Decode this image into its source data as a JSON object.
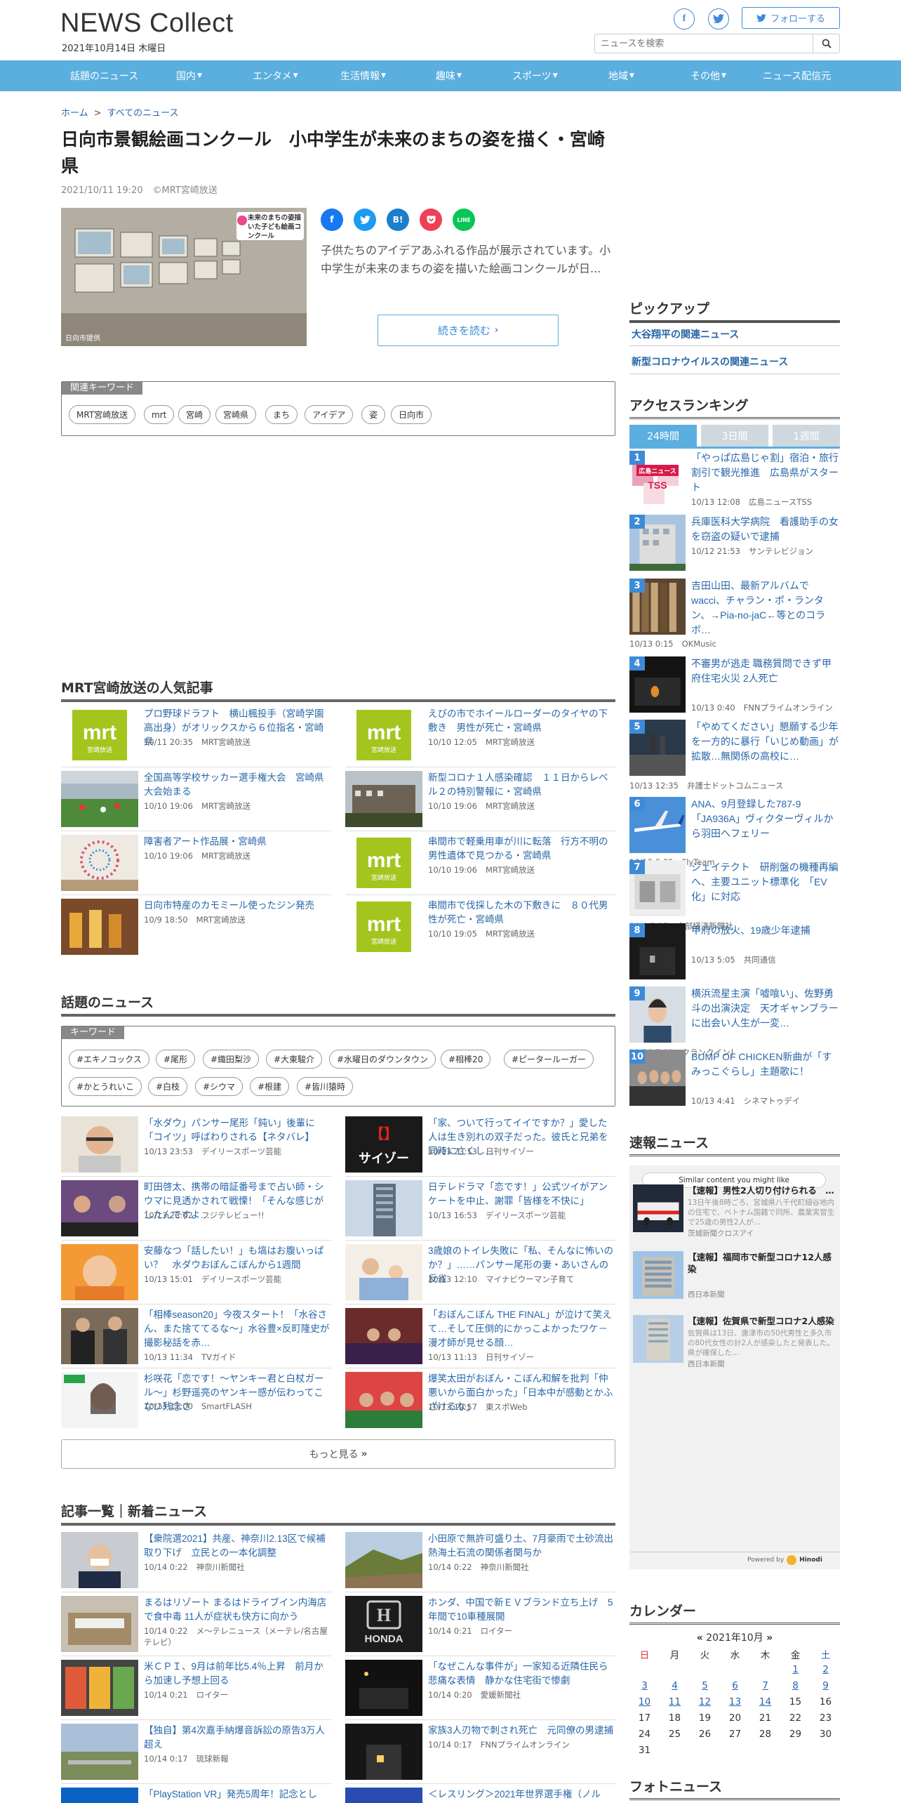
{
  "header": {
    "logo": "NEWS Collect",
    "date": "2021年10月14日 木曜日",
    "follow_label": "フォローする",
    "search_placeholder": "ニュースを検索"
  },
  "nav": [
    "話題のニュース",
    "国内",
    "エンタメ",
    "生活情報",
    "趣味",
    "スポーツ",
    "地域",
    "その他",
    "ニュース配信元"
  ],
  "breadcrumb": {
    "home": "ホーム",
    "sep": ">",
    "current": "すべてのニュース"
  },
  "article": {
    "title": "日向市景観絵画コンクール　小中学生が未来のまちの姿を描く・宮崎県",
    "date": "2021/10/11 19:20",
    "source": "©MRT宮崎放送",
    "image_credit": "日向市提供",
    "image_caption": "未来のまちの姿描いた子ども絵画コンクール",
    "lead": "子供たちのアイデアあふれる作品が展示されています。小中学生が未来のまちの姿を描いた絵画コンクールが日...",
    "read_more": "続きを読む",
    "share": [
      "f",
      "t",
      "B!",
      "P",
      "LINE"
    ]
  },
  "related_keywords": {
    "label": "関連キーワード",
    "items": [
      "MRT宮崎放送",
      "mrt",
      "宮崎",
      "宮崎県",
      "まち",
      "アイデア",
      "姿",
      "日向市"
    ]
  },
  "popular": {
    "title": "MRT宮崎放送の人気記事",
    "logo_text": "mrt",
    "logo_sub": "宮崎放送",
    "items": [
      {
        "title": "プロ野球ドラフト　横山楓投手（宮崎学園高出身）がオリックスから６位指名・宮崎県",
        "time": "10/11 20:35",
        "source": "MRT宮崎放送",
        "thumb": "logo"
      },
      {
        "title": "えびの市でホイールローダーのタイヤの下敷き　男性が死亡・宮崎県",
        "time": "10/10 12:05",
        "source": "MRT宮崎放送",
        "thumb": "logo"
      },
      {
        "title": "全国高等学校サッカー選手権大会　宮崎県大会始まる",
        "time": "10/10 19:06",
        "source": "MRT宮崎放送",
        "thumb": "soccer"
      },
      {
        "title": "新型コロナ１人感染確認　１１日からレベル２の特別警報に・宮崎県",
        "time": "10/10 19:06",
        "source": "MRT宮崎放送",
        "thumb": "building"
      },
      {
        "title": "障害者アート作品展・宮崎県",
        "time": "10/10 19:06",
        "source": "MRT宮崎放送",
        "thumb": "art"
      },
      {
        "title": "串間市で軽乗用車が川に転落　行方不明の男性遺体で見つかる・宮崎県",
        "time": "10/10 19:06",
        "source": "MRT宮崎放送",
        "thumb": "logo"
      },
      {
        "title": "日向市特産のカモミール使ったジン発売",
        "time": "10/9 18:50",
        "source": "MRT宮崎放送",
        "thumb": "bottles"
      },
      {
        "title": "串間市で伐採した木の下敷きに　８０代男性が死亡・宮崎県",
        "time": "10/10 19:05",
        "source": "MRT宮崎放送",
        "thumb": "logo"
      }
    ]
  },
  "topics": {
    "title": "話題のニュース",
    "keyword_label": "キーワード",
    "keywords": [
      "#エキノコックス",
      "#尾形",
      "#織田梨沙",
      "#大東駿介",
      "#水曜日のダウンタウン",
      "#相棒20",
      "#ピータールーガー",
      "#かとうれいこ",
      "#白枝",
      "#シウマ",
      "#根建",
      "#皆川猿時"
    ],
    "items": [
      {
        "title": "「水ダウ」パンサー尾形「鈍い」後輩に「コイツ」呼ばわりされる【ネタバレ】",
        "time": "10/13 23:53",
        "source": "デイリースポーツ芸能",
        "thumb": "face"
      },
      {
        "title": "「家、ついて行ってイイですか？」愛した人は生き別れの双子だった。彼氏と兄弟を同時に亡くし…",
        "time": "10/13 23:13",
        "source": "日刊サイゾー",
        "thumb": "sayzo",
        "thumb_text": "サイゾー"
      },
      {
        "title": "町田啓太、携帯の暗証番号まで占い師・シウマに見透かされて戦慄！「そんな感じがしたんですよ…",
        "time": "10/13 23:02",
        "source": "フジテレビュー!!",
        "thumb": "studio"
      },
      {
        "title": "日テレドラマ「恋です！」公式ツイがアンケートを中止、謝罪「皆様を不快に」",
        "time": "10/13 16:53",
        "source": "デイリースポーツ芸能",
        "thumb": "tower"
      },
      {
        "title": "安藤なつ「話したい！」も塙はお腹いっぱい？　水ダウおぼんこぼんから1週間",
        "time": "10/13 15:01",
        "source": "デイリースポーツ芸能",
        "thumb": "orange"
      },
      {
        "title": "3歳娘のトイレ失敗に「私、そんなに怖いのか？」……パンサー尾形の妻・あいさんの反省",
        "time": "10/13 12:10",
        "source": "マイナビウーマン子育て",
        "thumb": "family"
      },
      {
        "title": "「相棒season20」今夜スタート！「水谷さん、また捨ててるな～」水谷豊×反町隆史が撮影秘話を赤…",
        "time": "10/13 11:34",
        "source": "TVガイド",
        "thumb": "suits"
      },
      {
        "title": "「おぼんこぼん THE FINAL」が泣けて笑えて…そして圧倒的にかっこよかったワケ－漫才師が見せる顔…",
        "time": "10/13 11:13",
        "source": "日刊サイゾー",
        "thumb": "stage"
      },
      {
        "title": "杉咲花「恋です！～ヤンキー君と白杖ガール～」杉野遥亮のヤンキー感が伝わってこない残念さ",
        "time": "10/13 11:00",
        "source": "SmartFLASH",
        "thumb": "woman"
      },
      {
        "title": "爆笑太田がおぼん・こぼん和解を批判「仲悪いから面白かった」「日本中が感動とかふざけるな」",
        "time": "10/13 10:57",
        "source": "東スポWeb",
        "thumb": "comedy"
      }
    ]
  },
  "more_label": "もっと見る",
  "latest": {
    "title": "記事一覧｜新着ニュース",
    "items": [
      {
        "title": "【衆院選2021】共産、神奈川2.13区で候補取り下げ　立民との一本化調整",
        "time": "10/14 0:22",
        "source": "神奈川新聞社",
        "thumb": "face2"
      },
      {
        "title": "小田原で無許可盛り土、7月豪雨で土砂流出　熱海土石流の関係者関与か",
        "time": "10/14 0:22",
        "source": "神奈川新聞社",
        "thumb": "hill"
      },
      {
        "title": "まるはリゾート まるはドライブイン内海店で食中毒 11人が症状も快方に向かう",
        "time": "10/14 0:22",
        "source": "メ～テレニュース（メーテレ/名古屋テレビ）",
        "thumb": "shop"
      },
      {
        "title": "ホンダ、中国で新ＥＶブランド立ち上げ　5年間で10車種展開",
        "time": "10/14 0:21",
        "source": "ロイター",
        "thumb": "honda",
        "thumb_text": "HONDA"
      },
      {
        "title": "米ＣＰＩ、9月は前年比5.4％上昇　前月から加速し予想上回る",
        "time": "10/14 0:21",
        "source": "ロイター",
        "thumb": "market"
      },
      {
        "title": "「なぜこんな事件が」一家知る近隣住民ら悲痛な表情　静かな住宅街で惨劇",
        "time": "10/14 0:20",
        "source": "愛媛新聞社",
        "thumb": "night"
      },
      {
        "title": "【独自】第4次嘉手納爆音訴訟の原告3万人超え",
        "time": "10/14 0:17",
        "source": "琉球新報",
        "thumb": "airfield"
      },
      {
        "title": "家族3人刃物で刺され死亡　元同僚の男逮捕",
        "time": "10/14 0:17",
        "source": "FNNプライムオンライン",
        "thumb": "night2"
      },
      {
        "title": "「PlayStation VR」発売5周年！記念とし",
        "time": "",
        "source": "",
        "thumb": "ps"
      },
      {
        "title": "＜レスリング＞2021年世界選手権（ノル",
        "time": "",
        "source": "",
        "thumb": "blue"
      }
    ]
  },
  "sidebar": {
    "pickup": {
      "title": "ピックアップ",
      "items": [
        "大谷翔平の関連ニュース",
        "新型コロナウイルスの関連ニュース"
      ]
    },
    "ranking": {
      "title": "アクセスランキング",
      "tabs": [
        "24時間",
        "3日間",
        "1週間"
      ],
      "items": [
        {
          "rank": "1",
          "title": "「やっぱ広島じゃ割」宿泊・旅行割引で観光推進　広島県がスタート",
          "time": "10/13 12:08",
          "source": "広島ニュースTSS",
          "thumb": "tss",
          "thumb_text": "広島ニュース",
          "thumb_text2": "TSS"
        },
        {
          "rank": "2",
          "title": "兵庫医科大学病院　看護助手の女を窃盗の疑いで逮捕",
          "time": "10/12 21:53",
          "source": "サンテレビジョン",
          "thumb": "hospital"
        },
        {
          "rank": "3",
          "title": "吉田山田、最新アルバムでwacci、チャラン・ポ・ランタン、→Pia-no-jaC←等とのコラボ…",
          "time": "10/13 0:15",
          "source": "OKMusic",
          "thumb": "books"
        },
        {
          "rank": "4",
          "title": "不審男が逃走 職務質問できず甲府住宅火災 2人死亡",
          "time": "10/13 0:40",
          "source": "FNNプライムオンライン",
          "thumb": "night3"
        },
        {
          "rank": "5",
          "title": "「やめてください」懇願する少年を一方的に暴行「いじめ動画」が拡散…無関係の高校に…",
          "time": "10/13 12:35",
          "source": "弁護士ドットコムニュース",
          "thumb": "street"
        },
        {
          "rank": "6",
          "title": "ANA、9月登録した787-9「JA936A」ヴィクターヴィルから羽田へフェリー",
          "time": "10/13 8:35",
          "source": "FlyTeam",
          "thumb": "plane"
        },
        {
          "rank": "7",
          "title": "ジェイテクト　研削盤の機種再編へ、主要ユニット標準化　「EV化」に対応",
          "time": "10/8 5:15",
          "source": "中部経済新聞社",
          "thumb": "factory"
        },
        {
          "rank": "8",
          "title": "甲府の放火、19歳少年逮捕",
          "time": "10/13 5:05",
          "source": "共同通信",
          "thumb": "night4"
        },
        {
          "rank": "9",
          "title": "横浜流星主演「嘘喰い」、佐野勇斗の出演決定　天才ギャンブラーに出会い人生が一変…",
          "time": "10/13 7:08",
          "source": "クランクイン！",
          "thumb": "man"
        },
        {
          "rank": "10",
          "title": "BUMP OF CHICKEN新曲が「すみっこぐらし」主題歌に！",
          "time": "10/13 4:41",
          "source": "シネマトゥデイ",
          "thumb": "band"
        }
      ]
    },
    "breaking": {
      "title": "速報ニュース",
      "similar_label": "Similar content you might like",
      "powered": "Powered by",
      "powered_brand": "Hinodi",
      "items": [
        {
          "title": "【速報】男性2人切り付けられる　…",
          "desc": "13日午後8時ごろ、宮城県八千代町細谷地内の住宅で、ベトナム国籍で同所、農業実習生で25歳の男性2人が…",
          "source": "茨城新聞クロスアイ",
          "thumb": "police"
        },
        {
          "title": "【速報】福岡市で新型コロナ12人感染",
          "desc": "",
          "source": "西日本新聞",
          "thumb": "cityhall"
        },
        {
          "title": "【速報】佐賀県で新型コロナ2人感染",
          "desc": "佐賀県は13日、唐津市の50代男性と多久市の80代女性の計2人が感染したと発表した。県が確保した…",
          "source": "西日本新聞",
          "thumb": "saga"
        }
      ]
    },
    "calendar": {
      "title": "カレンダー",
      "month": "2021年10月",
      "prev": "«",
      "next": "»",
      "weekdays": [
        "日",
        "月",
        "火",
        "水",
        "木",
        "金",
        "土"
      ],
      "weeks": [
        [
          "",
          "",
          "",
          "",
          "",
          "1",
          "2"
        ],
        [
          "3",
          "4",
          "5",
          "6",
          "7",
          "8",
          "9"
        ],
        [
          "10",
          "11",
          "12",
          "13",
          "14",
          "15",
          "16"
        ],
        [
          "17",
          "18",
          "19",
          "20",
          "21",
          "22",
          "23"
        ],
        [
          "24",
          "25",
          "26",
          "27",
          "28",
          "29",
          "30"
        ],
        [
          "31",
          "",
          "",
          "",
          "",
          "",
          ""
        ]
      ],
      "linked_days": [
        "1",
        "2",
        "3",
        "4",
        "5",
        "6",
        "7",
        "8",
        "9",
        "10",
        "11",
        "12",
        "13",
        "14"
      ]
    },
    "photo_title": "フォトニュース"
  },
  "colors": {
    "nav": "#5aafdf",
    "link": "#2766a8",
    "rank": "#3d8bd8",
    "mrt": "#a4c51d"
  }
}
